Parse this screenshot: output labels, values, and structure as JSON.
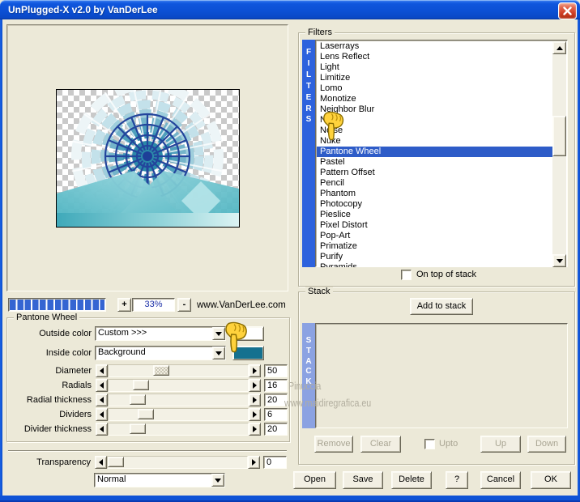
{
  "window": {
    "title": "UnPlugged-X v2.0 by VanDerLee"
  },
  "preview": {
    "zoom_in_label": "+",
    "zoom_level": "33%",
    "zoom_out_label": "-",
    "website": "www.VanDerLee.com"
  },
  "filter_panel": {
    "group_label": "Pantone Wheel",
    "color_rows": [
      {
        "label": "Outside color",
        "value": "Custom >>>",
        "swatch_color": "#ffffff"
      },
      {
        "label": "Inside color",
        "value": "Background",
        "swatch_color": "#15718f"
      }
    ],
    "sliders": [
      {
        "label": "Diameter",
        "value": "50",
        "pos": 36,
        "focused": true
      },
      {
        "label": "Radials",
        "value": "16",
        "pos": 20,
        "focused": false
      },
      {
        "label": "Radial thickness",
        "value": "20",
        "pos": 17,
        "focused": false
      },
      {
        "label": "Dividers",
        "value": "6",
        "pos": 24,
        "focused": false
      },
      {
        "label": "Divider thickness",
        "value": "20",
        "pos": 17,
        "focused": false
      }
    ],
    "transparency": {
      "label": "Transparency",
      "value": "0",
      "pos": 0,
      "focused": false
    },
    "blend_mode": "Normal"
  },
  "filters": {
    "group_label": "Filters",
    "vertical_label": "FILTERS",
    "selected_item": "Pantone Wheel",
    "items": [
      "Laserrays",
      "Lens Reflect",
      "Light",
      "Limitize",
      "Lomo",
      "Monotize",
      "Neighbor Blur",
      "Neon",
      "Noise",
      "Nuke",
      "Pantone Wheel",
      "Pastel",
      "Pattern Offset",
      "Pencil",
      "Phantom",
      "Photocopy",
      "Pieslice",
      "Pixel Distort",
      "Pop-Art",
      "Primatize",
      "Purify",
      "Pyramids"
    ],
    "on_top_label": "On top of stack",
    "on_top_checked": false
  },
  "stack": {
    "group_label": "Stack",
    "add_button_label": "Add to stack",
    "vertical_label": "STACK",
    "watermark": {
      "line1": "Pinuccia",
      "line2": "www.maidiregrafica.eu"
    },
    "remove_label": "Remove",
    "clear_label": "Clear",
    "upto_label": "Upto",
    "upto_checked": false,
    "up_label": "Up",
    "down_label": "Down"
  },
  "actions": {
    "open": "Open",
    "save": "Save",
    "delete": "Delete",
    "help": "?",
    "cancel": "Cancel",
    "ok": "OK"
  },
  "colors": {
    "titlebar_blue": "#0f54d7",
    "selection_blue": "#2e5cc8",
    "filters_bar_blue": "#2d62dd",
    "stack_bar_blue": "#8ba2e2",
    "outside_swatch": "#ffffff",
    "inside_swatch": "#15718f",
    "progress_blue": "#3565d2"
  }
}
